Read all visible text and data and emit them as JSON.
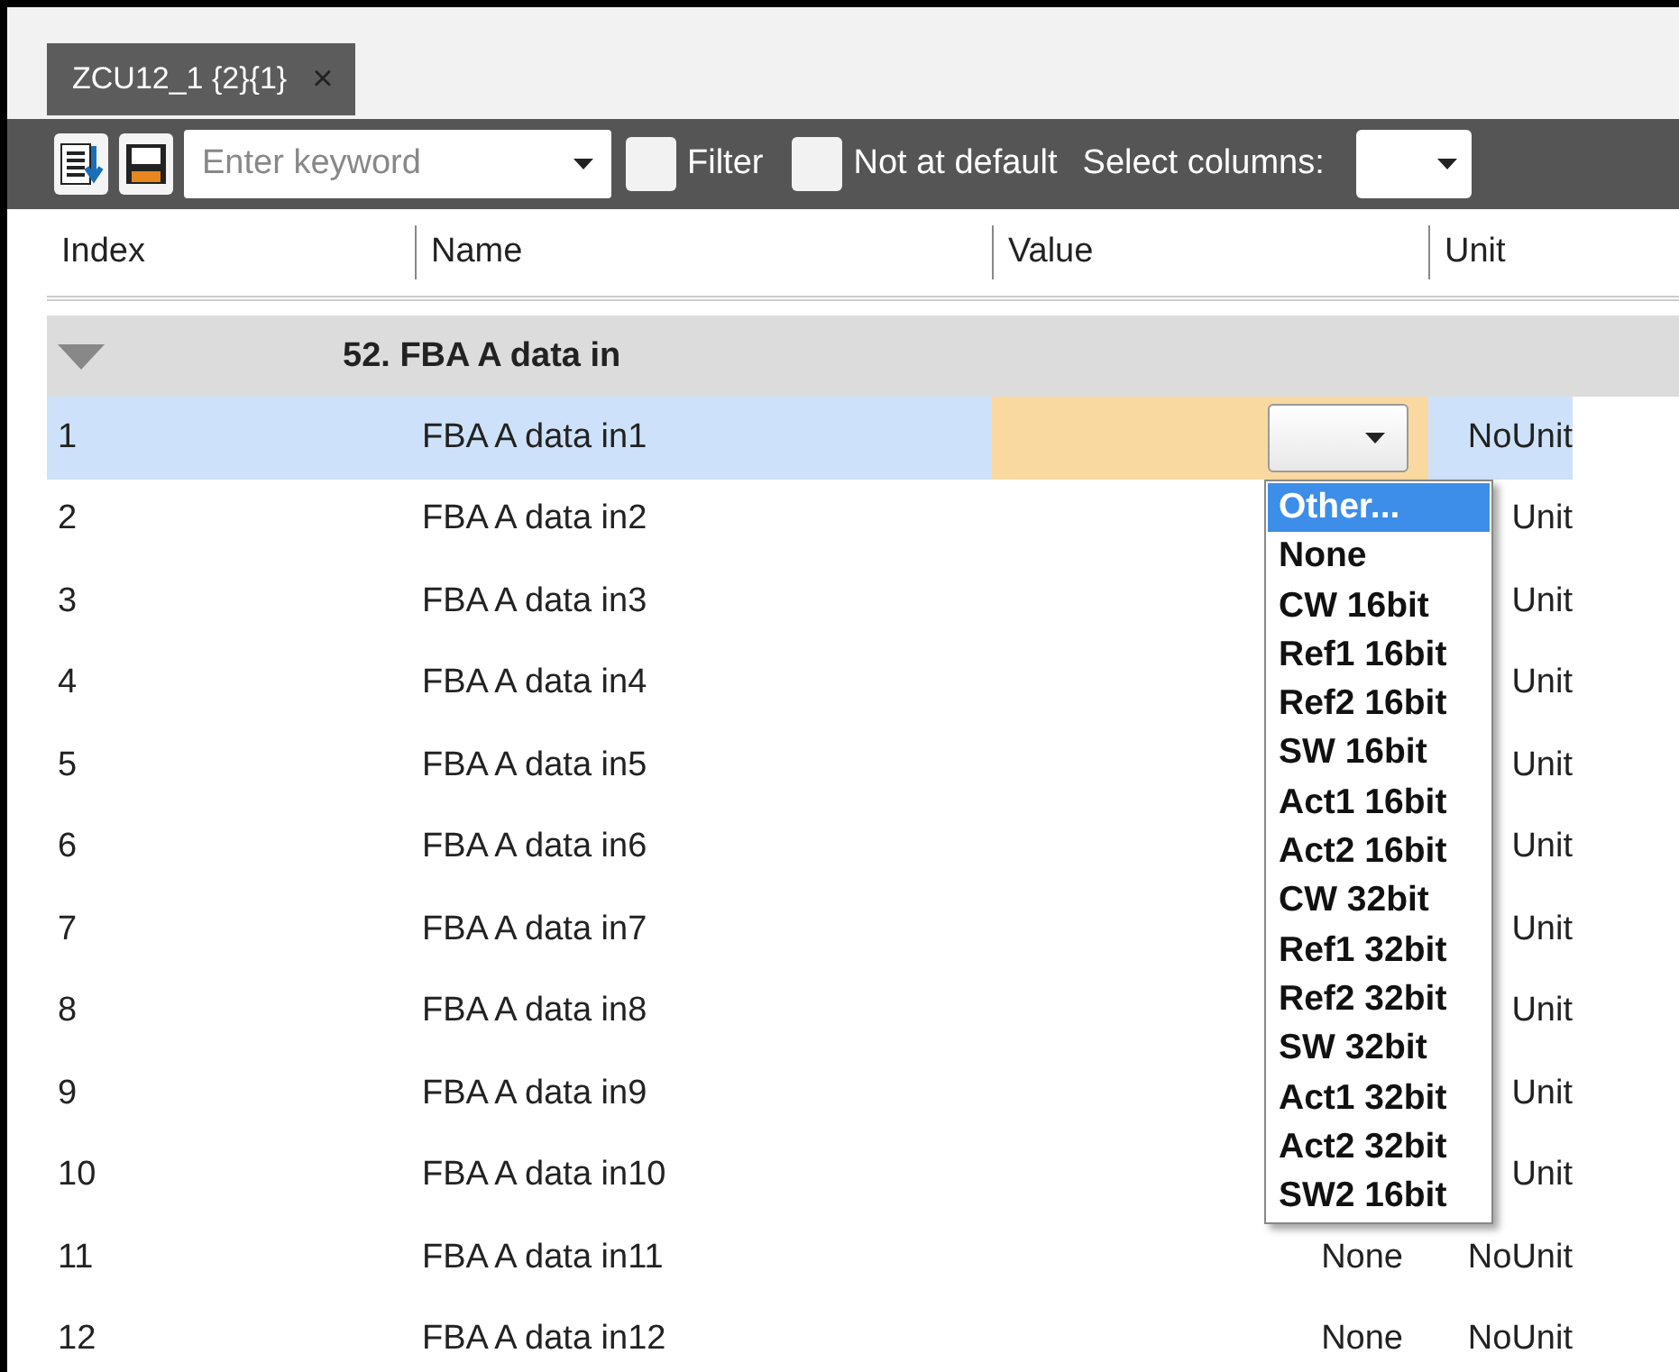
{
  "tabs": [
    {
      "label": "ZCU12_1 {2}{1}",
      "close": "×",
      "selected": true
    }
  ],
  "toolbar": {
    "search": {
      "placeholder": "Enter keyword"
    },
    "filter": {
      "label": "Filter",
      "checked": false
    },
    "not_at_default": {
      "label": "Not at default",
      "checked": false
    },
    "select_columns": {
      "label": "Select columns:"
    }
  },
  "table": {
    "columns": [
      "Index",
      "Name",
      "Value",
      "Unit"
    ],
    "group": {
      "label": "52. FBA A data in",
      "expanded": true
    },
    "rows": [
      {
        "index": "1",
        "name": "FBA A data in1",
        "value": "",
        "unit": "NoUnit",
        "selected": true,
        "editing": true
      },
      {
        "index": "2",
        "name": "FBA A data in2",
        "value": "",
        "unit": "Unit",
        "selected": false,
        "editing": false
      },
      {
        "index": "3",
        "name": "FBA A data in3",
        "value": "",
        "unit": "Unit",
        "selected": false,
        "editing": false
      },
      {
        "index": "4",
        "name": "FBA A data in4",
        "value": "",
        "unit": "Unit",
        "selected": false,
        "editing": false
      },
      {
        "index": "5",
        "name": "FBA A data in5",
        "value": "",
        "unit": "Unit",
        "selected": false,
        "editing": false
      },
      {
        "index": "6",
        "name": "FBA A data in6",
        "value": "",
        "unit": "Unit",
        "selected": false,
        "editing": false
      },
      {
        "index": "7",
        "name": "FBA A data in7",
        "value": "",
        "unit": "Unit",
        "selected": false,
        "editing": false
      },
      {
        "index": "8",
        "name": "FBA A data in8",
        "value": "",
        "unit": "Unit",
        "selected": false,
        "editing": false
      },
      {
        "index": "9",
        "name": "FBA A data in9",
        "value": "",
        "unit": "Unit",
        "selected": false,
        "editing": false
      },
      {
        "index": "10",
        "name": "FBA A data in10",
        "value": "",
        "unit": "Unit",
        "selected": false,
        "editing": false
      },
      {
        "index": "11",
        "name": "FBA A data in11",
        "value": "None",
        "unit": "NoUnit",
        "selected": false,
        "editing": false
      },
      {
        "index": "12",
        "name": "FBA A data in12",
        "value": "None",
        "unit": "NoUnit",
        "selected": false,
        "editing": false
      }
    ]
  },
  "dropdown": {
    "options": [
      {
        "label": "Other...",
        "selected": true
      },
      {
        "label": "None",
        "selected": false
      },
      {
        "label": "CW 16bit",
        "selected": false
      },
      {
        "label": "Ref1 16bit",
        "selected": false
      },
      {
        "label": "Ref2 16bit",
        "selected": false
      },
      {
        "label": "SW 16bit",
        "selected": false
      },
      {
        "label": "Act1 16bit",
        "selected": false
      },
      {
        "label": "Act2 16bit",
        "selected": false
      },
      {
        "label": "CW 32bit",
        "selected": false
      },
      {
        "label": "Ref1 32bit",
        "selected": false
      },
      {
        "label": "Ref2 32bit",
        "selected": false
      },
      {
        "label": "SW 32bit",
        "selected": false
      },
      {
        "label": "Act1 32bit",
        "selected": false
      },
      {
        "label": "Act2 32bit",
        "selected": false
      },
      {
        "label": "SW2 16bit",
        "selected": false
      }
    ]
  }
}
